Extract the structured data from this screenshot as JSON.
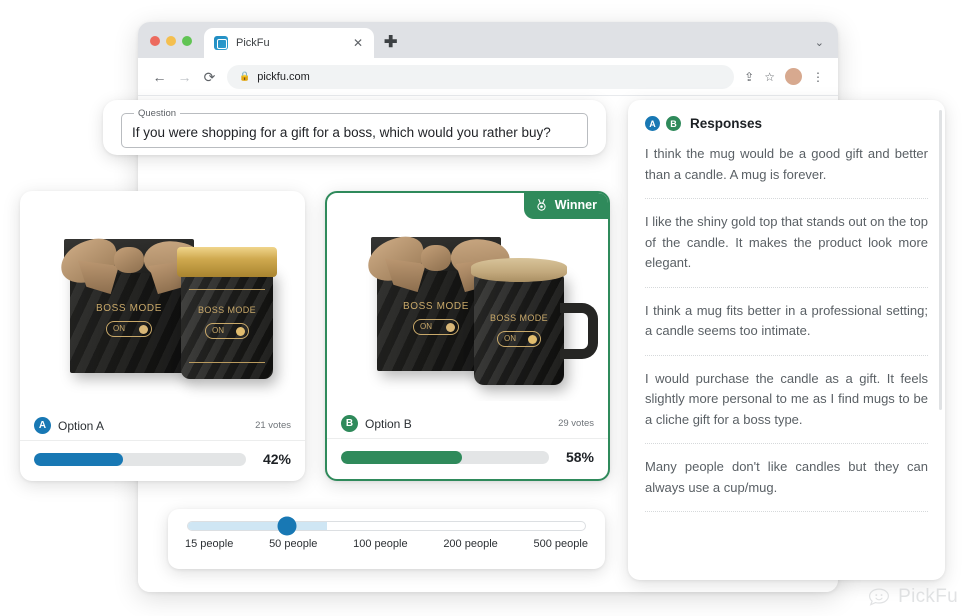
{
  "browser": {
    "traffic_lights": [
      "close",
      "minimize",
      "maximize"
    ],
    "tab": {
      "title": "PickFu",
      "favicon": "pickfu-favicon",
      "close_label": "✕"
    },
    "new_tab_label": "✚",
    "tab_list_caret": "⌄",
    "nav": {
      "back": "←",
      "forward": "→",
      "reload": "⟳"
    },
    "omnibox": {
      "lock_icon": "🔒",
      "url": "pickfu.com"
    },
    "toolbar_icons": {
      "share": "⇪",
      "bookmark": "☆",
      "menu": "⋮"
    }
  },
  "question": {
    "legend": "Question",
    "value": "If you were shopping for a gift for a boss, which would you rather buy?"
  },
  "options": [
    {
      "id": "a",
      "badge": "A",
      "name": "Option A",
      "votes": "21 votes",
      "percent": "42%",
      "percent_value": 42,
      "color": "#1878b4",
      "winner": false,
      "product": {
        "brand_line": "BOSS MODE",
        "toggle_label": "ON",
        "item": "candle-jar"
      }
    },
    {
      "id": "b",
      "badge": "B",
      "name": "Option B",
      "votes": "29 votes",
      "percent": "58%",
      "percent_value": 58,
      "color": "#2f8a5b",
      "winner": true,
      "winner_label": "Winner",
      "winner_icon": "medal-icon",
      "product": {
        "brand_line": "BOSS MODE",
        "toggle_label": "ON",
        "item": "mug"
      }
    }
  ],
  "audience_slider": {
    "selected": "50 people",
    "ticks": [
      "15 people",
      "50 people",
      "100 people",
      "200 people",
      "500 people"
    ],
    "thumb_color": "#1878b4"
  },
  "responses": {
    "title": "Responses",
    "badges": [
      "A",
      "B"
    ],
    "items": [
      "I think the mug would be a good gift and better than a candle. A mug is forever.",
      "I like the shiny gold top that stands out on the top of the candle. It makes the product look more elegant.",
      "I think a mug fits better in a professional setting; a candle seems too intimate.",
      "I would purchase the candle as a gift. It feels slightly more personal to me as I find mugs to be a cliche gift for a boss type.",
      "Many people don't like candles but they can always use a cup/mug."
    ]
  },
  "watermark": {
    "text": "PickFu",
    "logo": "pickfu-smiley-bubble-logo"
  }
}
